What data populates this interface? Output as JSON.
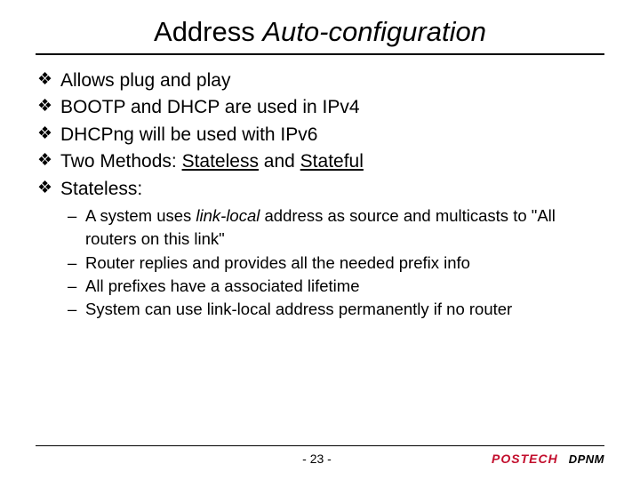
{
  "title_plain": "Address ",
  "title_italic": "Auto-configuration",
  "bullets": {
    "b0": "Allows plug and play",
    "b1": "BOOTP and DHCP are used in IPv4",
    "b2": "DHCPng will be used with IPv6",
    "b3_pre": "Two Methods: ",
    "b3_u1": "Stateless",
    "b3_mid": " and ",
    "b3_u2": "Stateful",
    "b4": "Stateless:"
  },
  "sub": {
    "s0_pre": "A system uses ",
    "s0_i": "link-local",
    "s0_post": " address as source and multicasts to \"All routers on this link\"",
    "s1": "Router replies and provides all the needed prefix info",
    "s2": "All prefixes have a associated lifetime",
    "s3": "System can use link-local address permanently if no router"
  },
  "footer": {
    "page": "- 23 -",
    "postech": "POSTECH",
    "dpnm": "DPNM"
  }
}
